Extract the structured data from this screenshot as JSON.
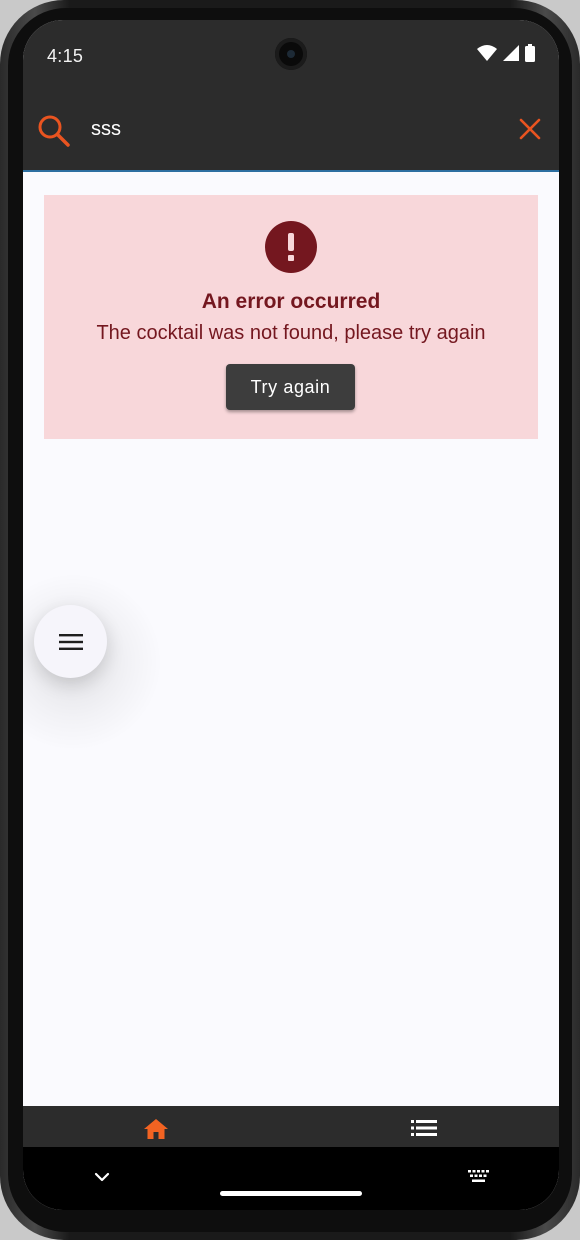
{
  "status_bar": {
    "time": "4:15"
  },
  "search": {
    "query": "sss",
    "icon": "search-icon",
    "clear_icon": "close-icon"
  },
  "error_card": {
    "title": "An error occurred",
    "message": "The cocktail was not found, please try again",
    "retry_label": "Try again"
  },
  "fab": {
    "icon": "menu-icon"
  },
  "bottom_nav": {
    "items": [
      {
        "icon": "home-icon",
        "active": true
      },
      {
        "icon": "list-icon",
        "active": false
      }
    ]
  },
  "colors": {
    "accent": "#e95420",
    "error_bg": "#f8d7da",
    "error_text": "#74171f",
    "toolbar_bg": "#2c2c2c",
    "button_bg": "#3d3d3d"
  }
}
